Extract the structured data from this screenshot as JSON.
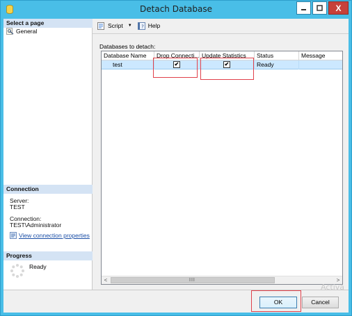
{
  "window": {
    "title": "Detach Database",
    "icons": {
      "app": "database-cylinder-icon",
      "minimize": "minimize-icon",
      "maximize": "maximize-icon",
      "close": "close-icon"
    },
    "close_glyph": "X"
  },
  "left_pane": {
    "select_page_header": "Select a page",
    "pages": [
      {
        "label": "General",
        "icon": "page-wrench-icon"
      }
    ],
    "connection_header": "Connection",
    "server_label": "Server:",
    "server_value": "TEST",
    "connection_label": "Connection:",
    "connection_value": "TEST\\Administrator",
    "view_connection_link": "View connection properties",
    "progress_header": "Progress",
    "progress_status": "Ready"
  },
  "toolbar": {
    "script_label": "Script",
    "script_dropdown_glyph": "▼",
    "help_label": "Help"
  },
  "main": {
    "databases_label": "Databases to detach:",
    "columns": [
      "Database Name",
      "Drop Connecti...",
      "Update Statistics",
      "Status",
      "Message"
    ],
    "rows": [
      {
        "database_name": "test",
        "drop_connections": true,
        "update_statistics": true,
        "status": "Ready",
        "message": ""
      }
    ],
    "check_glyph": "✔",
    "scroll_left_glyph": "<",
    "scroll_right_glyph": ">",
    "scroll_grip": "III"
  },
  "buttons": {
    "ok": "OK",
    "cancel": "Cancel"
  },
  "watermark": "Activa",
  "colors": {
    "titlebar": "#49bee7",
    "highlight": "#e0404a",
    "selected_row": "#cce8ff",
    "section_header": "#d4e3f4"
  }
}
